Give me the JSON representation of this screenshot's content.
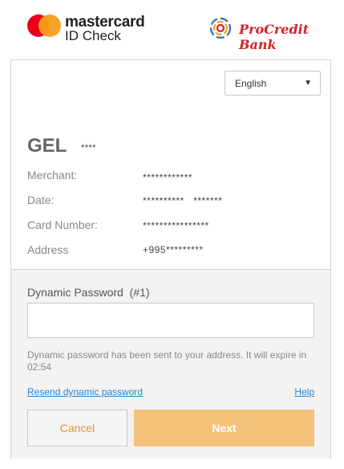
{
  "header": {
    "mastercard_brand": "mastercard",
    "mastercard_product": "ID Check",
    "bank_name": "ProCredit Bank"
  },
  "language": {
    "selected": "English"
  },
  "transaction": {
    "currency": "GEL",
    "amount": "****",
    "rows": [
      {
        "label": "Merchant:",
        "value": "************"
      },
      {
        "label": "Date:",
        "value": "**********   *******"
      },
      {
        "label": "Card Number:",
        "value": "****************"
      },
      {
        "label": "Address",
        "value": "+995*********"
      }
    ]
  },
  "auth": {
    "password_label": "Dynamic Password  (#1)",
    "password_value": "",
    "info_text": "Dynamic password has been sent to your address. It will expire in 02:54",
    "resend_link": "Resend dynamic password",
    "help_link": "Help",
    "cancel_label": "Cancel",
    "next_label": "Next"
  },
  "colors": {
    "mastercard_red": "#eb001b",
    "mastercard_yellow": "#f79e1b",
    "bank_red": "#d3232a",
    "link_blue": "#2a83c6",
    "next_button": "#f4c27b",
    "cancel_text": "#e9922b"
  }
}
